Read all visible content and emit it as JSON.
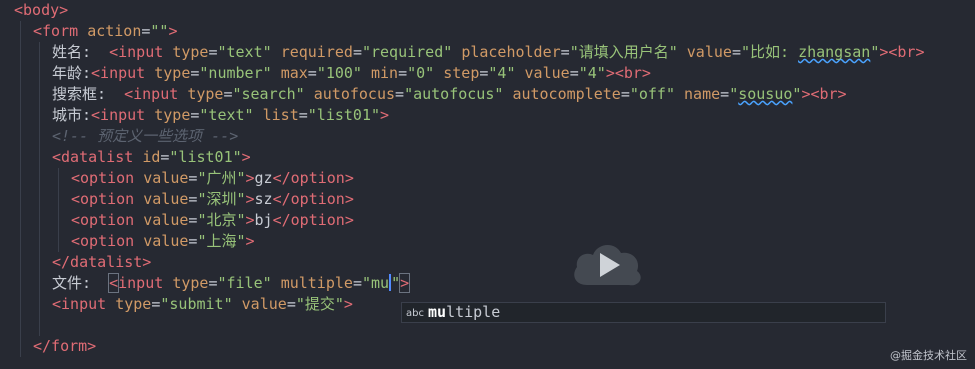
{
  "editor": {
    "lines": [
      {
        "indent": 0,
        "tokens": [
          {
            "c": "tag",
            "t": "<body>"
          }
        ]
      },
      {
        "indent": 1,
        "tokens": [
          {
            "c": "tag",
            "t": "<form "
          },
          {
            "c": "attr",
            "t": "action"
          },
          {
            "c": "punct",
            "t": "="
          },
          {
            "c": "str",
            "t": "\"\""
          },
          {
            "c": "tag",
            "t": ">"
          }
        ]
      },
      {
        "indent": 2,
        "tokens": [
          {
            "c": "text",
            "t": "姓名:  "
          },
          {
            "c": "tag",
            "t": "<input "
          },
          {
            "c": "attr",
            "t": "type"
          },
          {
            "c": "punct",
            "t": "="
          },
          {
            "c": "str",
            "t": "\"text\""
          },
          {
            "c": "text",
            "t": " "
          },
          {
            "c": "attr",
            "t": "required"
          },
          {
            "c": "punct",
            "t": "="
          },
          {
            "c": "str",
            "t": "\"required\""
          },
          {
            "c": "text",
            "t": " "
          },
          {
            "c": "attr",
            "t": "placeholder"
          },
          {
            "c": "punct",
            "t": "="
          },
          {
            "c": "str",
            "t": "\"请填入用户名\""
          },
          {
            "c": "text",
            "t": " "
          },
          {
            "c": "attr",
            "t": "value"
          },
          {
            "c": "punct",
            "t": "="
          },
          {
            "c": "str",
            "t": "\"比如: "
          },
          {
            "c": "str squiggle",
            "t": "zhangsan"
          },
          {
            "c": "str",
            "t": "\""
          },
          {
            "c": "tag",
            "t": "><br>"
          }
        ]
      },
      {
        "indent": 2,
        "tokens": [
          {
            "c": "text",
            "t": "年龄:"
          },
          {
            "c": "tag",
            "t": "<input "
          },
          {
            "c": "attr",
            "t": "type"
          },
          {
            "c": "punct",
            "t": "="
          },
          {
            "c": "str",
            "t": "\"number\""
          },
          {
            "c": "text",
            "t": " "
          },
          {
            "c": "attr",
            "t": "max"
          },
          {
            "c": "punct",
            "t": "="
          },
          {
            "c": "str",
            "t": "\"100\""
          },
          {
            "c": "text",
            "t": " "
          },
          {
            "c": "attr",
            "t": "min"
          },
          {
            "c": "punct",
            "t": "="
          },
          {
            "c": "str",
            "t": "\"0\""
          },
          {
            "c": "text",
            "t": " "
          },
          {
            "c": "attr",
            "t": "step"
          },
          {
            "c": "punct",
            "t": "="
          },
          {
            "c": "str",
            "t": "\"4\""
          },
          {
            "c": "text",
            "t": " "
          },
          {
            "c": "attr",
            "t": "value"
          },
          {
            "c": "punct",
            "t": "="
          },
          {
            "c": "str",
            "t": "\"4\""
          },
          {
            "c": "tag",
            "t": "><br>"
          }
        ]
      },
      {
        "indent": 2,
        "tokens": [
          {
            "c": "text",
            "t": "搜索框:  "
          },
          {
            "c": "tag",
            "t": "<input "
          },
          {
            "c": "attr",
            "t": "type"
          },
          {
            "c": "punct",
            "t": "="
          },
          {
            "c": "str",
            "t": "\"search\""
          },
          {
            "c": "text",
            "t": " "
          },
          {
            "c": "attr",
            "t": "autofocus"
          },
          {
            "c": "punct",
            "t": "="
          },
          {
            "c": "str",
            "t": "\"autofocus\""
          },
          {
            "c": "text",
            "t": " "
          },
          {
            "c": "attr",
            "t": "autocomplete"
          },
          {
            "c": "punct",
            "t": "="
          },
          {
            "c": "str",
            "t": "\"off\""
          },
          {
            "c": "text",
            "t": " "
          },
          {
            "c": "attr",
            "t": "name"
          },
          {
            "c": "punct",
            "t": "="
          },
          {
            "c": "str",
            "t": "\""
          },
          {
            "c": "str squiggle",
            "t": "sousuo"
          },
          {
            "c": "str",
            "t": "\""
          },
          {
            "c": "tag",
            "t": "><br>"
          }
        ]
      },
      {
        "indent": 2,
        "tokens": [
          {
            "c": "text",
            "t": "城市:"
          },
          {
            "c": "tag",
            "t": "<input "
          },
          {
            "c": "attr",
            "t": "type"
          },
          {
            "c": "punct",
            "t": "="
          },
          {
            "c": "str",
            "t": "\"text\""
          },
          {
            "c": "text",
            "t": " "
          },
          {
            "c": "attr",
            "t": "list"
          },
          {
            "c": "punct",
            "t": "="
          },
          {
            "c": "str",
            "t": "\"list01\""
          },
          {
            "c": "tag",
            "t": ">"
          }
        ]
      },
      {
        "indent": 2,
        "tokens": [
          {
            "c": "comment",
            "t": "<!-- 预定义一些选项 -->"
          }
        ]
      },
      {
        "indent": 2,
        "tokens": [
          {
            "c": "tag",
            "t": "<datalist "
          },
          {
            "c": "attr",
            "t": "id"
          },
          {
            "c": "punct",
            "t": "="
          },
          {
            "c": "str",
            "t": "\"list01\""
          },
          {
            "c": "tag",
            "t": ">"
          }
        ]
      },
      {
        "indent": 3,
        "tokens": [
          {
            "c": "tag",
            "t": "<option "
          },
          {
            "c": "attr",
            "t": "value"
          },
          {
            "c": "punct",
            "t": "="
          },
          {
            "c": "str",
            "t": "\"广州\""
          },
          {
            "c": "tag",
            "t": ">"
          },
          {
            "c": "text",
            "t": "gz"
          },
          {
            "c": "tag",
            "t": "</option>"
          }
        ]
      },
      {
        "indent": 3,
        "tokens": [
          {
            "c": "tag",
            "t": "<option "
          },
          {
            "c": "attr",
            "t": "value"
          },
          {
            "c": "punct",
            "t": "="
          },
          {
            "c": "str",
            "t": "\"深圳\""
          },
          {
            "c": "tag",
            "t": ">"
          },
          {
            "c": "text",
            "t": "sz"
          },
          {
            "c": "tag",
            "t": "</option>"
          }
        ]
      },
      {
        "indent": 3,
        "tokens": [
          {
            "c": "tag",
            "t": "<option "
          },
          {
            "c": "attr",
            "t": "value"
          },
          {
            "c": "punct",
            "t": "="
          },
          {
            "c": "str",
            "t": "\"北京\""
          },
          {
            "c": "tag",
            "t": ">"
          },
          {
            "c": "text",
            "t": "bj"
          },
          {
            "c": "tag",
            "t": "</option>"
          }
        ]
      },
      {
        "indent": 3,
        "tokens": [
          {
            "c": "tag",
            "t": "<option "
          },
          {
            "c": "attr",
            "t": "value"
          },
          {
            "c": "punct",
            "t": "="
          },
          {
            "c": "str",
            "t": "\"上海\""
          },
          {
            "c": "tag",
            "t": ">"
          }
        ]
      },
      {
        "indent": 2,
        "tokens": [
          {
            "c": "tag",
            "t": "</datalist>"
          }
        ]
      },
      {
        "indent": 2,
        "tokens": [
          {
            "c": "text",
            "t": "文件:  "
          },
          {
            "c": "tag bracket-box",
            "t": "<"
          },
          {
            "c": "tag",
            "t": "input "
          },
          {
            "c": "attr",
            "t": "type"
          },
          {
            "c": "punct",
            "t": "="
          },
          {
            "c": "str",
            "t": "\"file\""
          },
          {
            "c": "text",
            "t": " "
          },
          {
            "c": "attr",
            "t": "multiple"
          },
          {
            "c": "punct",
            "t": "="
          },
          {
            "c": "str",
            "t": "\"mu"
          },
          {
            "c": "cursor",
            "t": ""
          },
          {
            "c": "str",
            "t": "\""
          },
          {
            "c": "tag bracket-box",
            "t": ">"
          }
        ]
      },
      {
        "indent": 2,
        "tokens": [
          {
            "c": "tag",
            "t": "<input "
          },
          {
            "c": "attr",
            "t": "type"
          },
          {
            "c": "punct",
            "t": "="
          },
          {
            "c": "str",
            "t": "\"submit\""
          },
          {
            "c": "text",
            "t": " "
          },
          {
            "c": "attr",
            "t": "value"
          },
          {
            "c": "punct",
            "t": "="
          },
          {
            "c": "str",
            "t": "\"提交\""
          },
          {
            "c": "tag",
            "t": ">"
          }
        ]
      },
      {
        "indent": 0,
        "tokens": []
      },
      {
        "indent": 1,
        "tokens": [
          {
            "c": "tag",
            "t": "</form>"
          }
        ]
      }
    ]
  },
  "autocomplete": {
    "kind_label": "abc",
    "match": "mu",
    "rest": "ltiple"
  },
  "watermark": "@掘金技术社区",
  "colors": {
    "background": "#262932",
    "tag": "#e06c75",
    "attribute": "#d19a66",
    "string": "#98c379",
    "comment": "#5c6370"
  },
  "icons": {
    "overlay": "play-icon"
  }
}
